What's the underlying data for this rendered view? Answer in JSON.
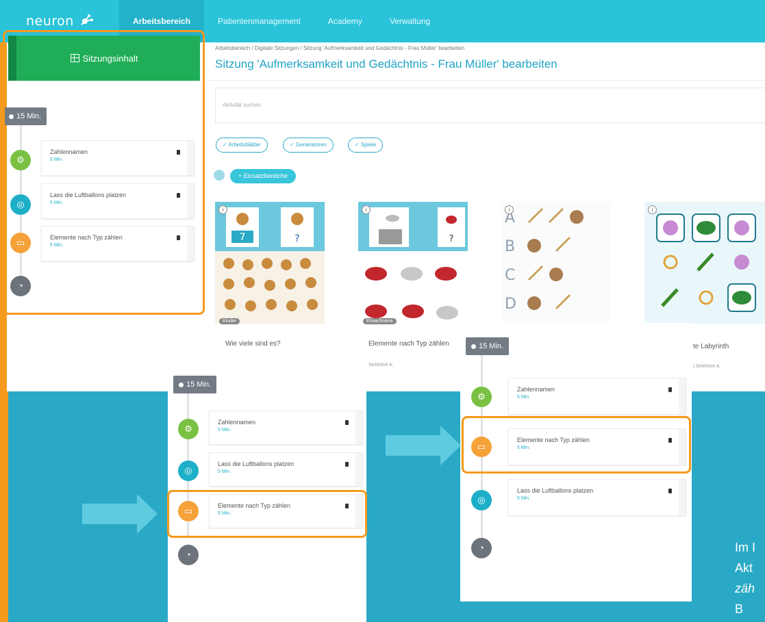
{
  "app": {
    "logo": "neuron"
  },
  "nav": {
    "items": [
      "Arbeitsbereich",
      "Patientenmanagement",
      "Academy",
      "Verwaltung"
    ]
  },
  "sidebar": {
    "header": "Sitzungsinhalt"
  },
  "timer": "15 Min.",
  "activities": [
    {
      "name": "Zahlennamen",
      "duration": "5 Min."
    },
    {
      "name": "Lass die Luftballons platzen",
      "duration": "5 Min."
    },
    {
      "name": "Elemente nach Typ zählen",
      "duration": "5 Min."
    }
  ],
  "breadcrumb": "Arbeitsbereich / Digitale Sitzungen / Sitzung 'Aufmerksamkeit und Gedächtnis - Frau Müller' bearbeiten",
  "page_title": "Sitzung 'Aufmerksamkeit und Gedächtnis - Frau Müller' bearbeiten",
  "search": {
    "placeholder": "Aktivität suchen"
  },
  "filters": [
    "Arbeitsblätter",
    "Generatoren",
    "Spiele"
  ],
  "einsatz_button": "+ Einsatzbereiche",
  "tiles": [
    {
      "title": "Wie viele sind es?",
      "tag": "Kinder",
      "sub": ""
    },
    {
      "title": "Elemente nach Typ zählen",
      "tag": "Erwachsene",
      "sub": "Selektive A."
    },
    {
      "title": "",
      "tag": "",
      "sub": ""
    },
    {
      "title": "te Labyrinth",
      "tag": "",
      "sub": "| Selektive A."
    }
  ],
  "caption": [
    "Im I",
    "Akt",
    "zäh",
    "B"
  ],
  "colors": {
    "accent": "#2ac3d9",
    "orange": "#f59a1c",
    "green": "#1fae57",
    "background": "#2aa9c6"
  }
}
